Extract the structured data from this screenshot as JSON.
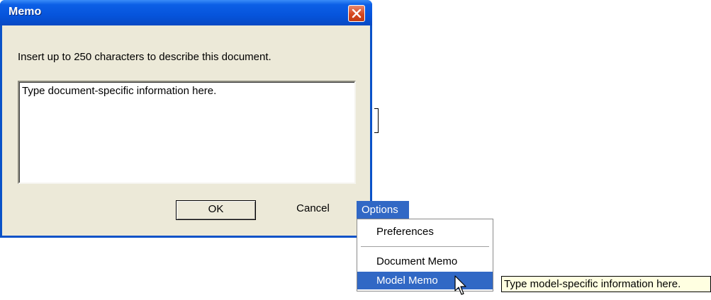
{
  "dialog": {
    "title": "Memo",
    "prompt": "Insert up to 250 characters to describe this document.",
    "memo_text": "Type document-specific information here.",
    "ok_label": "OK",
    "cancel_label": "Cancel"
  },
  "options_menu": {
    "header": "Options",
    "items": [
      {
        "label": "Preferences"
      },
      {
        "label": "Document Memo"
      },
      {
        "label": "Model Memo",
        "selected": true
      }
    ]
  },
  "tooltip": "Type model-specific information here.",
  "colors": {
    "titlebar": "#0654dc",
    "dialog_bg": "#ece9d8",
    "menu_highlight": "#3168c5",
    "tooltip_bg": "#ffffe1",
    "close_button": "#d6471f"
  },
  "icons": {
    "close": "close-icon",
    "cursor": "mouse-pointer-icon"
  }
}
